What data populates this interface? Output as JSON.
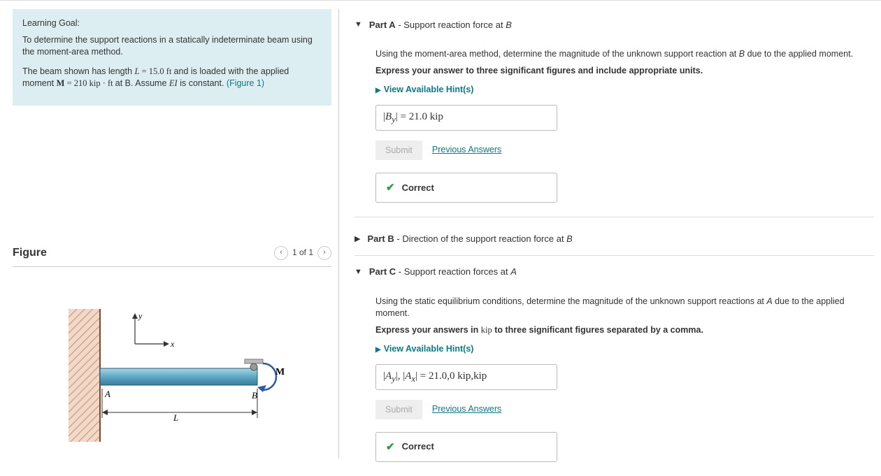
{
  "goal": {
    "heading": "Learning Goal:",
    "line1": "To determine the support reactions in a statically indeterminate beam using the moment-area method.",
    "line2_prefix": "The beam shown has length ",
    "L_sym": "L",
    "L_eq": " = 15.0 ft ",
    "line2_mid": "and is loaded with the applied moment ",
    "M_sym": "M",
    "M_eq": " = 210 kip · ft ",
    "at_b": " at B. Assume ",
    "EI": "EI",
    "const_txt": " is constant. ",
    "fig_link": "(Figure 1)"
  },
  "figure": {
    "title": "Figure",
    "page": "1 of 1",
    "labels": {
      "y": "y",
      "x": "x",
      "A": "A",
      "B": "B",
      "M": "M",
      "L": "L"
    }
  },
  "partA": {
    "label": "Part A",
    "suffix": " - Support reaction force at ",
    "suffix_var": "B",
    "q1": "Using the moment-area method, determine the magnitude of the unknown support reaction at ",
    "q1_var": "B",
    "q1_end": " due to the applied moment.",
    "instr": "Express your answer to three significant figures and include appropriate units.",
    "hints": "View Available Hint(s)",
    "answer_label": "|B",
    "answer_sub": "y",
    "answer_eq": "| = ",
    "answer_val": "21.0 kip",
    "submit": "Submit",
    "prev": "Previous Answers",
    "correct": "Correct"
  },
  "partB": {
    "label": "Part B",
    "suffix": " - Direction of the support reaction force at ",
    "suffix_var": "B"
  },
  "partC": {
    "label": "Part C",
    "suffix": " - Support reaction forces at ",
    "suffix_var": "A",
    "q1": "Using the static equilibrium conditions, determine the magnitude of the unknown support reactions at ",
    "q1_var": "A",
    "q1_end": " due to the applied moment.",
    "instr_pre": "Express your answers in ",
    "instr_unit": "kip",
    "instr_post": " to three significant figures separated by a comma.",
    "hints": "View Available Hint(s)",
    "answer_lhs": "|A_y|, |A_x| = ",
    "answer_val": "21.0,0  kip,kip",
    "submit": "Submit",
    "prev": "Previous Answers",
    "correct": "Correct"
  }
}
